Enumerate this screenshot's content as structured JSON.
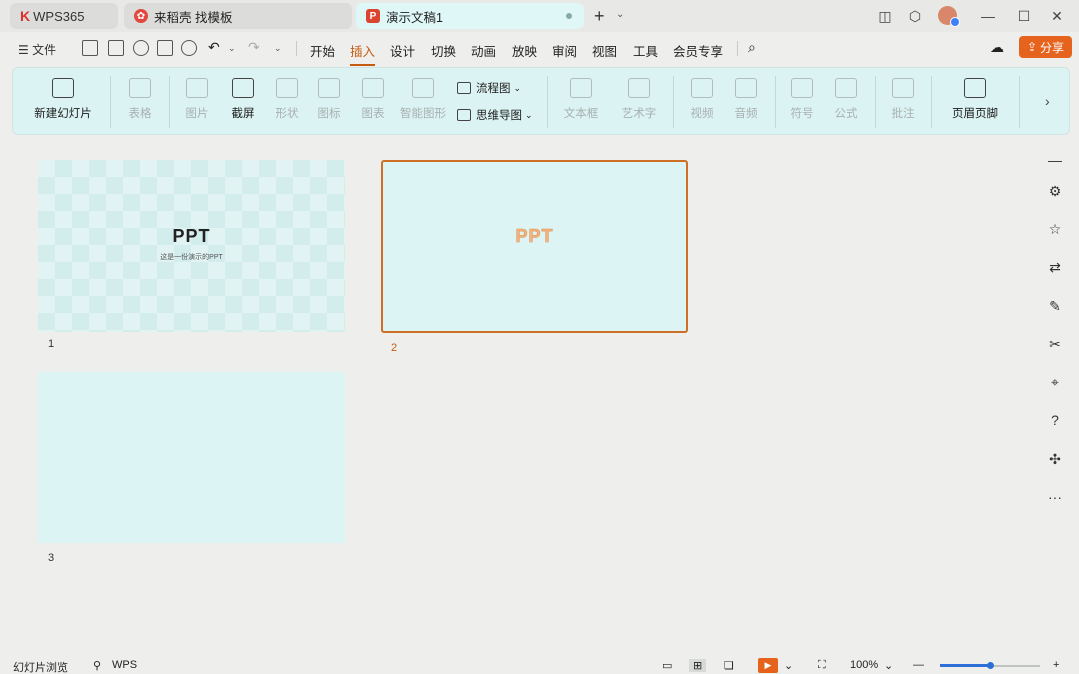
{
  "tabs": [
    {
      "logo": "K",
      "label": "WPS365"
    },
    {
      "label": "来稻壳 找模板"
    },
    {
      "label": "演示文稿1"
    }
  ],
  "menubar": {
    "file_label": "文件",
    "items": [
      "开始",
      "插入",
      "设计",
      "切换",
      "动画",
      "放映",
      "审阅",
      "视图",
      "工具",
      "会员专享"
    ],
    "active": "插入",
    "share_label": "分享"
  },
  "ribbon": {
    "new_slide": "新建幻灯片",
    "table": "表格",
    "picture": "图片",
    "screenshot": "截屏",
    "shape": "形状",
    "icon": "图标",
    "chart": "图表",
    "smartart": "智能图形",
    "flowchart": "流程图",
    "mindmap": "思维导图",
    "textbox": "文本框",
    "wordart": "艺术字",
    "video": "视频",
    "audio": "音频",
    "symbol": "符号",
    "formula": "公式",
    "comment": "批注",
    "header_footer": "页眉页脚"
  },
  "slides": [
    {
      "number": "1",
      "title": "PPT",
      "subtitle": "这是一份演示的PPT"
    },
    {
      "number": "2",
      "title": "PPT"
    },
    {
      "number": "3"
    }
  ],
  "statusbar": {
    "view_label": "幻灯片浏览",
    "wps_label": "WPS",
    "zoom": "100%",
    "zoom_fraction": 0.5
  },
  "colors": {
    "accent": "#e6631e",
    "active_tab_text": "#c55a11",
    "ribbon_bg": "#dbf3f2",
    "slide_bg": "#dcf4f4"
  }
}
